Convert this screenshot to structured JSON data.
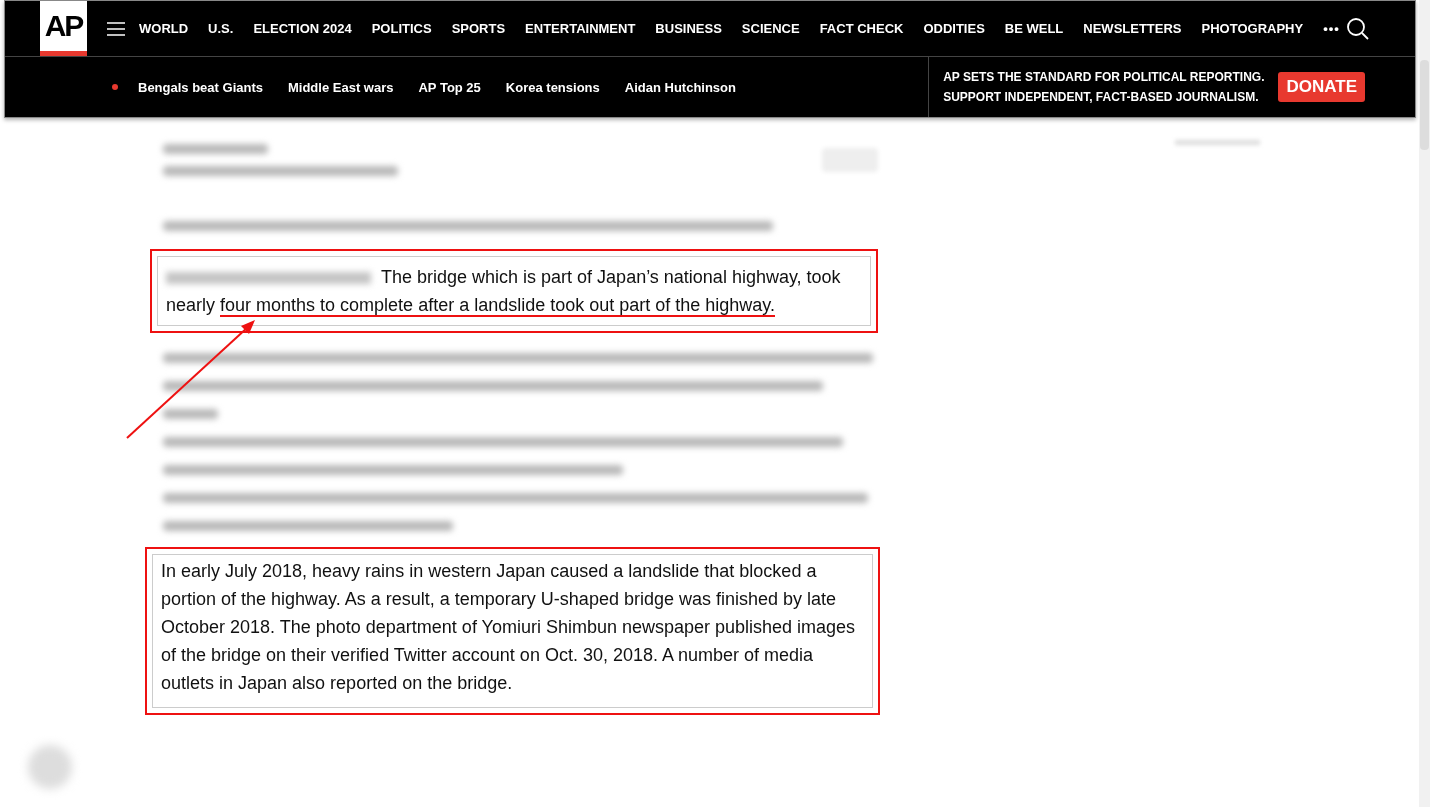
{
  "header": {
    "logo": "AP",
    "nav": [
      "WORLD",
      "U.S.",
      "ELECTION 2024",
      "POLITICS",
      "SPORTS",
      "ENTERTAINMENT",
      "BUSINESS",
      "SCIENCE",
      "FACT CHECK",
      "ODDITIES",
      "BE WELL",
      "NEWSLETTERS",
      "PHOTOGRAPHY"
    ],
    "more": "•••"
  },
  "trending": [
    "Bengals beat Giants",
    "Middle East wars",
    "AP Top 25",
    "Korea tensions",
    "Aidan Hutchinson"
  ],
  "promo": {
    "lines": [
      "AP SETS THE STANDARD FOR POLITICAL REPORTING.",
      "SUPPORT INDEPENDENT, FACT-BASED JOURNALISM."
    ],
    "button": "DONATE"
  },
  "assessment": {
    "text": "The bridge which is part of Japan’s national highway, took nearly ",
    "underlined": "four months to complete after a landslide took out part of the highway."
  },
  "highlight": {
    "text": "In early July 2018, heavy rains in western Japan caused a landslide that blocked a portion of the highway. As a result, a temporary U-shaped bridge was finished by late October 2018. The photo department of Yomiuri Shimbun newspaper published images of the bridge on their verified Twitter account on Oct. 30, 2018. A number of media outlets in Japan also reported on the bridge."
  }
}
